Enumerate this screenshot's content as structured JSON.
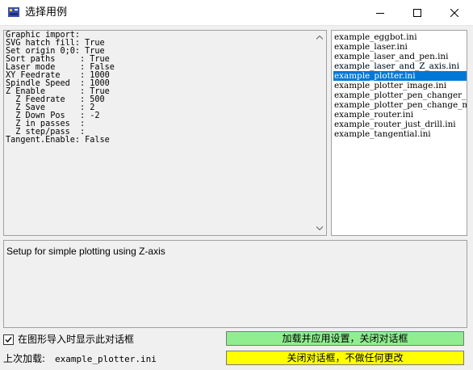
{
  "window": {
    "title": "选择用例",
    "app_icon": "printer-app-icon",
    "controls": [
      "minimize-icon",
      "maximize-icon",
      "close-icon"
    ]
  },
  "config_lines": [
    "Graphic import:",
    "SVG hatch fill: True",
    "Set origin 0;0: True",
    "Sort paths     : True",
    "Laser mode     : False",
    "XY Feedrate    : 1000",
    "Spindle Speed  : 1000",
    "Z Enable       : True",
    "  Z Feedrate   : 500",
    "  Z Save       : 2",
    "  Z Down Pos   : -2",
    "  Z in passes  :",
    "  Z step/pass  :",
    "Tangent.Enable: False"
  ],
  "files": [
    "example_eggbot.ini",
    "example_laser.ini",
    "example_laser_and_pen.ini",
    "example_laser_and_Z_axis.ini",
    "example_plotter.ini",
    "example_plotter_image.ini",
    "example_plotter_pen_changer_",
    "example_plotter_pen_change_m",
    "example_router.ini",
    "example_router_just_drill.ini",
    "example_tangential.ini"
  ],
  "selected_file_index": 4,
  "description": "Setup for simple plotting using Z-axis",
  "show_on_import": {
    "label": "在图形导入时显示此对话框",
    "checked": true
  },
  "last_load": {
    "label": "上次加载:",
    "value": "example_plotter.ini"
  },
  "buttons": {
    "load": "加载并应用设置，关闭对话框",
    "cancel": "关闭对话框，不做任何更改"
  },
  "colors": {
    "load_button": "#90ee90",
    "cancel_button": "#ffff00",
    "selection": "#0078d7"
  }
}
